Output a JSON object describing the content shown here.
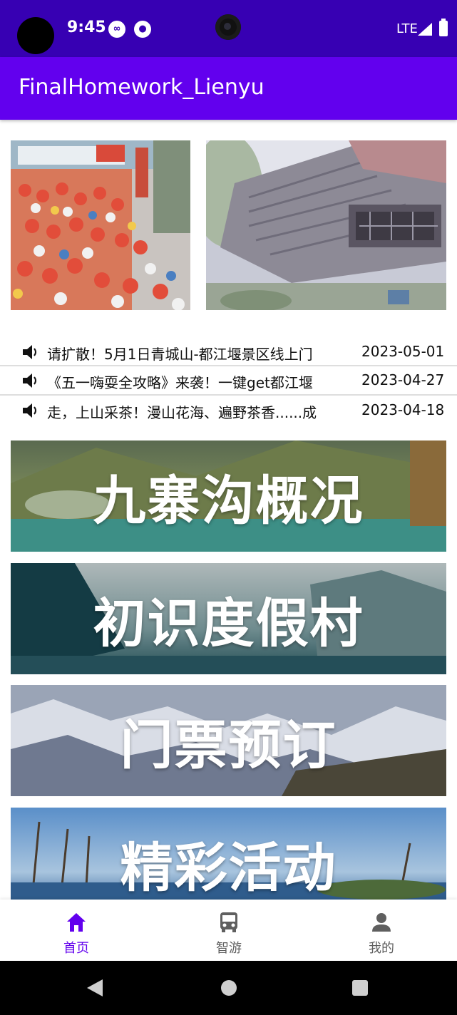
{
  "status_bar": {
    "time": "9:45",
    "network": "LTE",
    "icons": [
      "infinity-icon",
      "notification-icon",
      "signal-icon",
      "battery-icon"
    ]
  },
  "app_bar": {
    "title": "FinalHomework_Lienyu"
  },
  "news": [
    {
      "title": "请扩散！5月1日青城山-都江堰景区线上门",
      "date": "2023-05-01"
    },
    {
      "title": "《五一嗨耍全攻略》来袭！一键get都江堰",
      "date": "2023-04-27"
    },
    {
      "title": "走，上山采茶！漫山花海、遍野茶香......成",
      "date": "2023-04-18"
    }
  ],
  "features": [
    {
      "label": "九寨沟概况"
    },
    {
      "label": "初识度假村"
    },
    {
      "label": "门票预订"
    },
    {
      "label": "精彩活动"
    }
  ],
  "bottom_nav": [
    {
      "label": "首页",
      "icon": "home-icon",
      "active": true
    },
    {
      "label": "智游",
      "icon": "bus-icon",
      "active": false
    },
    {
      "label": "我的",
      "icon": "person-icon",
      "active": false
    }
  ],
  "colors": {
    "status_bar": "#3700b3",
    "app_bar": "#6200ee",
    "active_nav": "#6200ee",
    "inactive_nav": "#5f5f5f"
  }
}
